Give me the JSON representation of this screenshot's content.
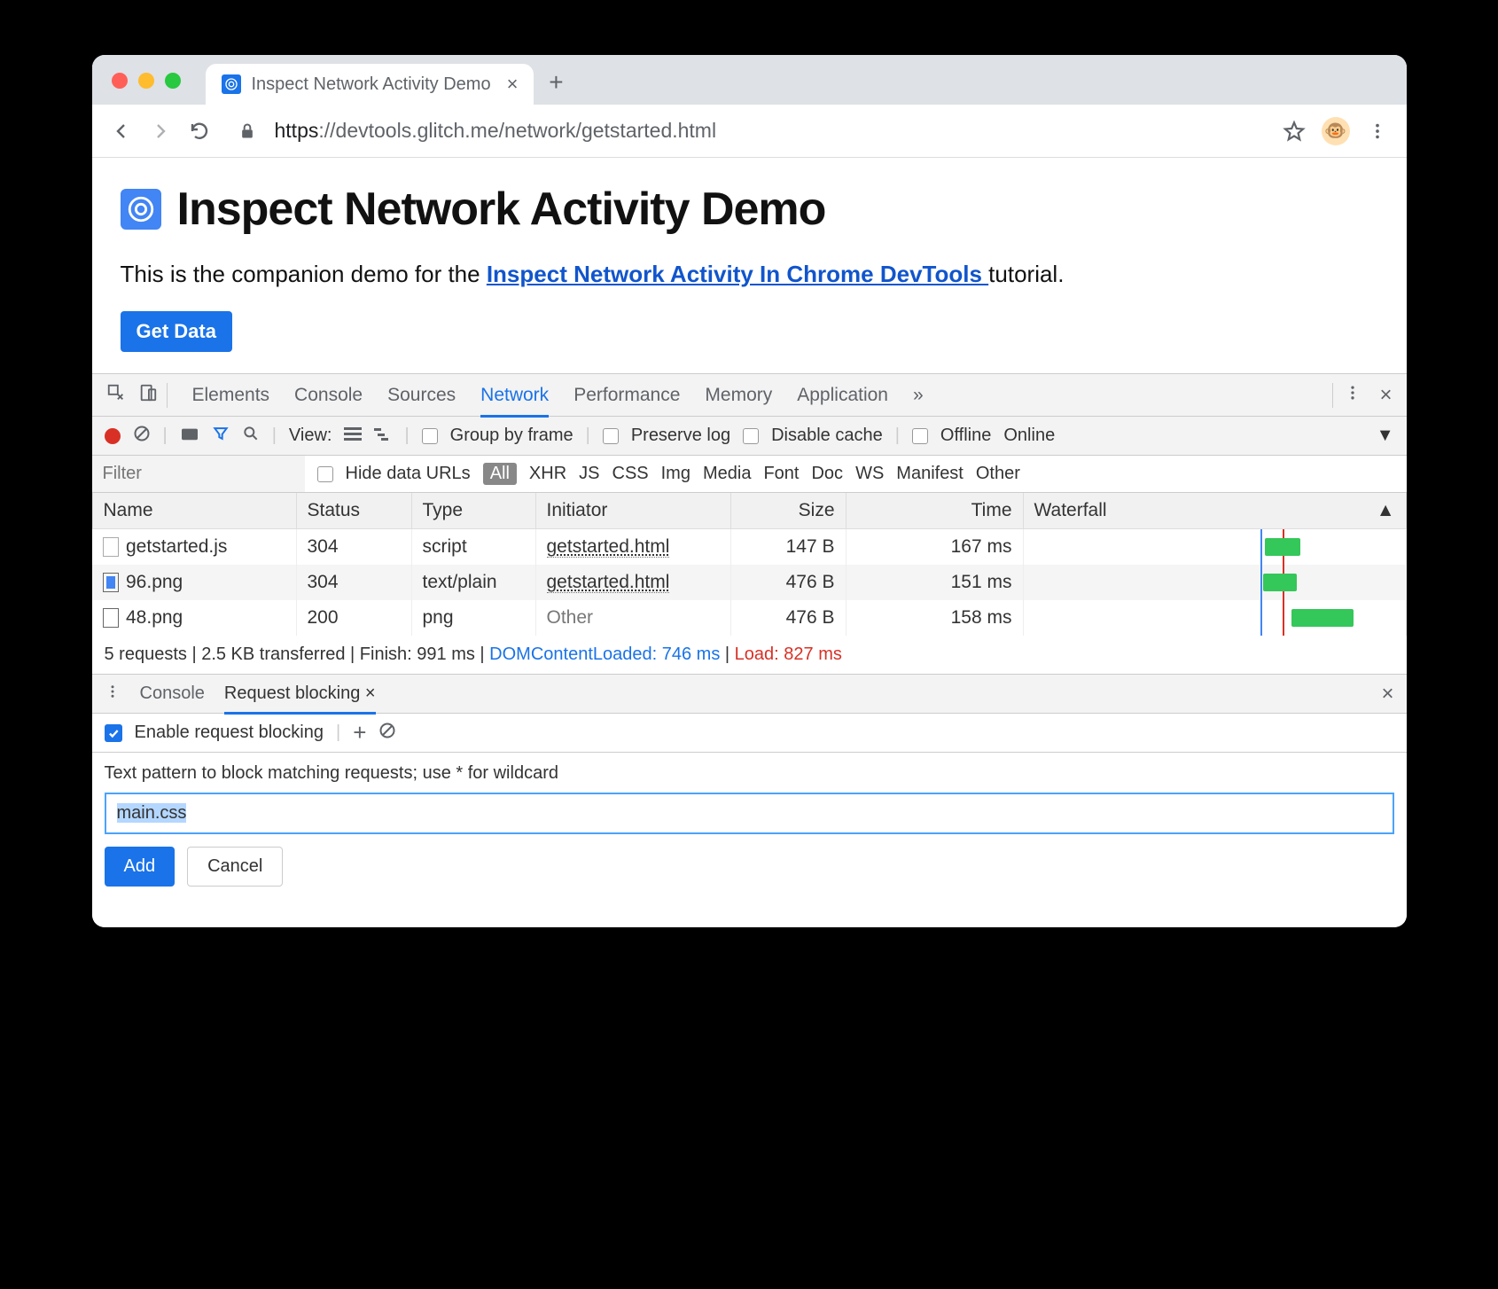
{
  "browser": {
    "tab_title": "Inspect Network Activity Demo",
    "url_scheme": "https",
    "url_rest": "://devtools.glitch.me/network/getstarted.html"
  },
  "page": {
    "heading": "Inspect Network Activity Demo",
    "sub_pre": "This is the companion demo for the ",
    "sub_link": "Inspect Network Activity In Chrome DevTools ",
    "sub_post": "tutorial.",
    "button": "Get Data"
  },
  "devtools": {
    "tabs": [
      "Elements",
      "Console",
      "Sources",
      "Network",
      "Performance",
      "Memory",
      "Application"
    ],
    "active_tab": "Network",
    "toolbar": {
      "view_label": "View:",
      "group": "Group by frame",
      "preserve": "Preserve log",
      "disable": "Disable cache",
      "offline": "Offline",
      "online": "Online"
    },
    "filter_placeholder": "Filter",
    "hide_urls": "Hide data URLs",
    "types": [
      "All",
      "XHR",
      "JS",
      "CSS",
      "Img",
      "Media",
      "Font",
      "Doc",
      "WS",
      "Manifest",
      "Other"
    ],
    "columns": [
      "Name",
      "Status",
      "Type",
      "Initiator",
      "Size",
      "Time",
      "Waterfall"
    ],
    "rows": [
      {
        "name": "getstarted.js",
        "status": "304",
        "type": "script",
        "initiator": "getstarted.html",
        "size": "147 B",
        "time": "167 ms"
      },
      {
        "name": "96.png",
        "status": "304",
        "type": "text/plain",
        "initiator": "getstarted.html",
        "size": "476 B",
        "time": "151 ms"
      },
      {
        "name": "48.png",
        "status": "200",
        "type": "png",
        "initiator": "Other",
        "size": "476 B",
        "time": "158 ms"
      }
    ],
    "status": {
      "text": "5 requests | 2.5 KB transferred | Finish: 991 ms | ",
      "dcl": "DOMContentLoaded: 746 ms",
      "sep": " | ",
      "load": "Load: 827 ms"
    }
  },
  "drawer": {
    "tabs": [
      "Console",
      "Request blocking"
    ],
    "active": "Request blocking",
    "enable_label": "Enable request blocking",
    "hint": "Text pattern to block matching requests; use * for wildcard",
    "input_value": "main.css",
    "add": "Add",
    "cancel": "Cancel"
  }
}
